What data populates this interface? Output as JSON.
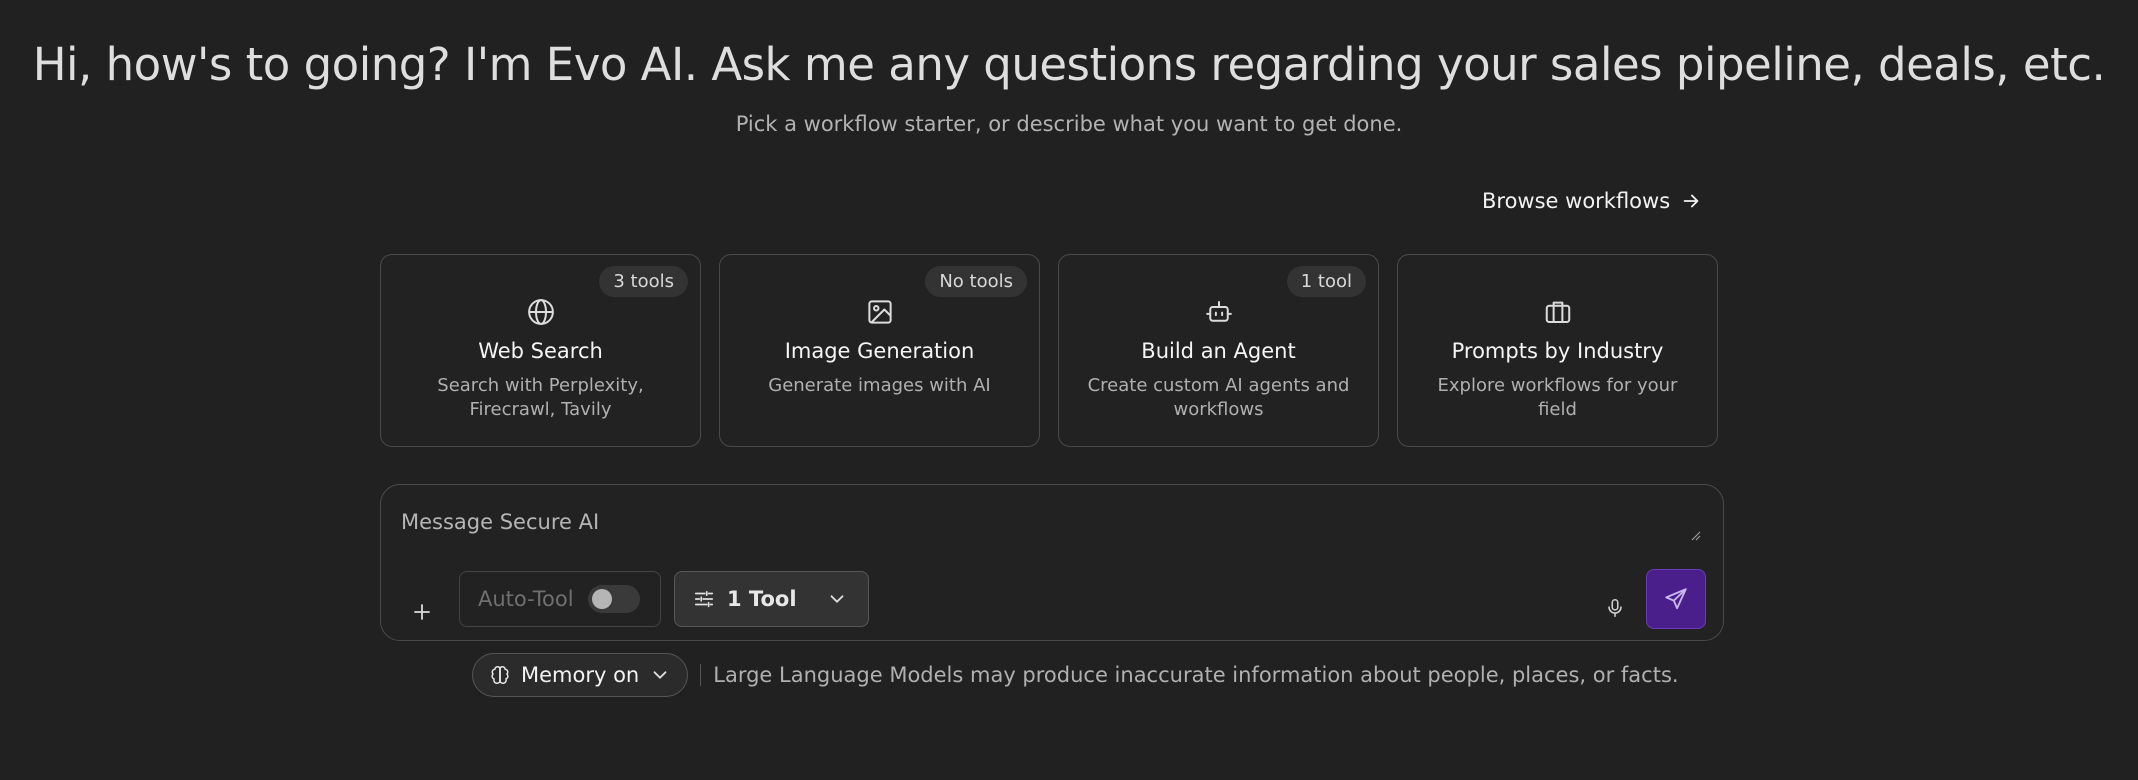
{
  "hero": {
    "title": "Hi, how's to going? I'm Evo AI. Ask me any questions regarding your sales pipeline, deals, etc.",
    "subtitle": "Pick a workflow starter, or describe what you want to get done."
  },
  "browse": {
    "label": "Browse workflows",
    "icon": "arrow-right-icon"
  },
  "cards": [
    {
      "badge": "3 tools",
      "icon": "globe-icon",
      "title": "Web Search",
      "desc": "Search with Perplexity, Firecrawl, Tavily"
    },
    {
      "badge": "No tools",
      "icon": "image-icon",
      "title": "Image Generation",
      "desc": "Generate images with AI"
    },
    {
      "badge": "1 tool",
      "icon": "robot-icon",
      "title": "Build an Agent",
      "desc": "Create custom AI agents and workflows"
    },
    {
      "badge": "",
      "icon": "briefcase-icon",
      "title": "Prompts by Industry",
      "desc": "Explore workflows for your field"
    }
  ],
  "composer": {
    "placeholder": "Message Secure AI",
    "value": "",
    "auto_tool_label": "Auto-Tool",
    "auto_tool_on": false,
    "tool_select_label": "1 Tool",
    "send_color": "#4a1f8c"
  },
  "footer": {
    "memory_label": "Memory on",
    "disclaimer": "Large Language Models may produce inaccurate information about people, places, or facts."
  }
}
